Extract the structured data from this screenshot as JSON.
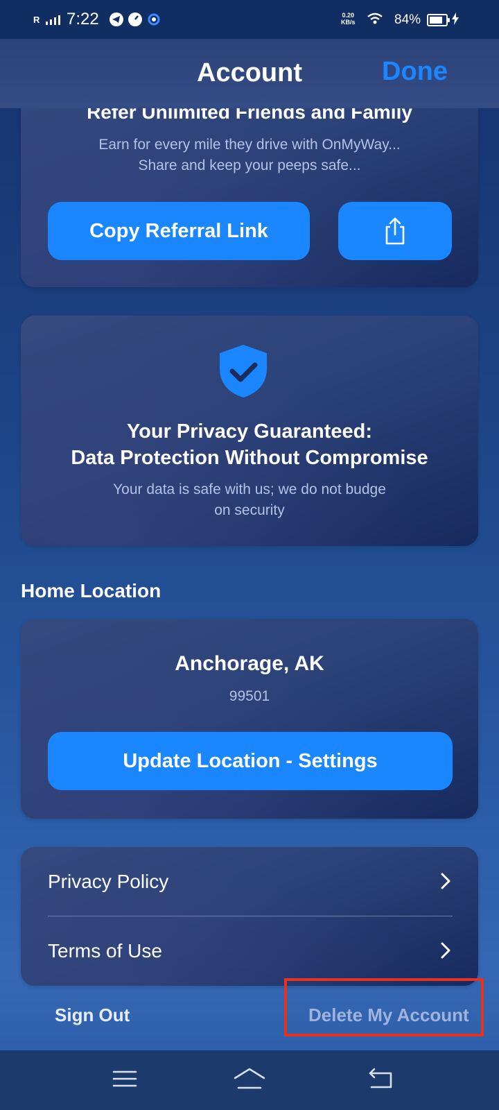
{
  "status_bar": {
    "carrier_indicator": "R",
    "time": "7:22",
    "speed_value": "0.20",
    "speed_unit": "KB/s",
    "battery_percent": "84%",
    "battery_level": 0.84
  },
  "header": {
    "title": "Account",
    "done_label": "Done"
  },
  "referral_card": {
    "title": "Refer Unlimited Friends and Family",
    "subtitle_line1": "Earn for every mile they drive with OnMyWay...",
    "subtitle_line2": "Share and keep your peeps safe...",
    "copy_button_label": "Copy Referral Link",
    "share_icon": "share-icon"
  },
  "privacy_card": {
    "icon": "shield-check-icon",
    "title_line1": "Your Privacy Guaranteed:",
    "title_line2": "Data Protection Without Compromise",
    "subtitle_line1": "Your data is safe with us; we do not budge",
    "subtitle_line2": "on security"
  },
  "home_location": {
    "section_label": "Home Location",
    "city": "Anchorage, AK",
    "zip": "99501",
    "update_button_label": "Update Location - Settings"
  },
  "links": [
    {
      "label": "Privacy Policy",
      "icon": "chevron-right-icon"
    },
    {
      "label": "Terms of Use",
      "icon": "chevron-right-icon"
    }
  ],
  "footer": {
    "sign_out_label": "Sign Out",
    "delete_account_label": "Delete My Account"
  },
  "colors": {
    "accent": "#1a86ff",
    "highlight": "#e5331f"
  }
}
